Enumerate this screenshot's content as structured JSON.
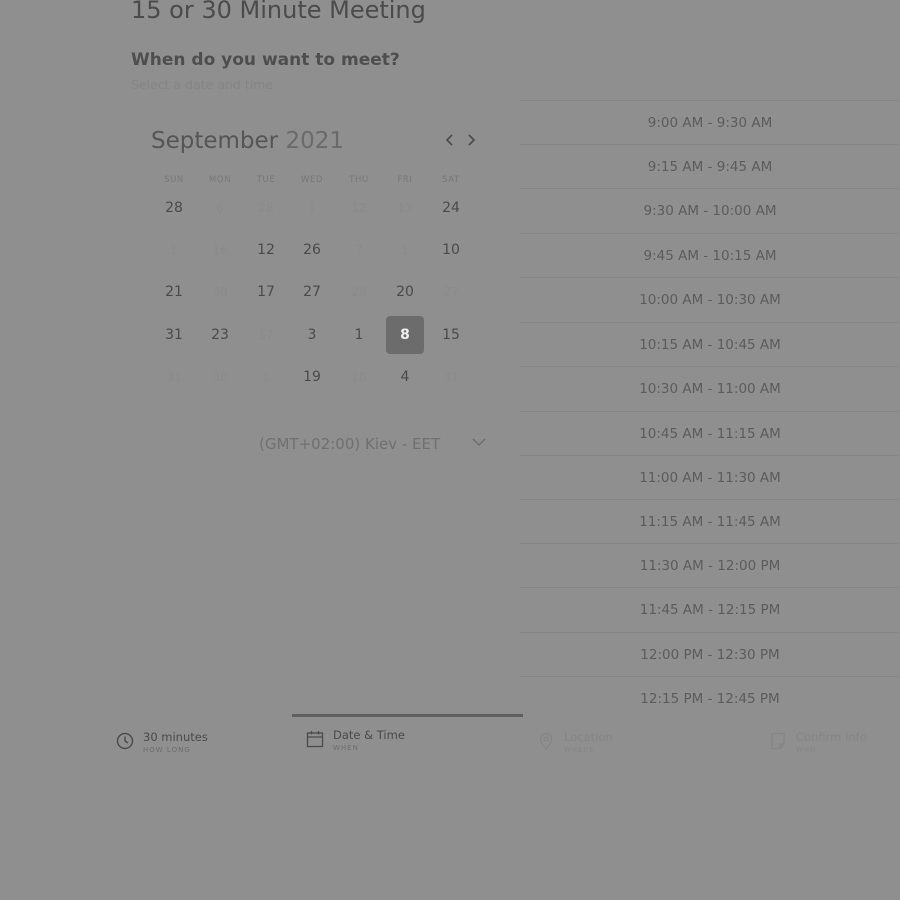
{
  "page": {
    "title": "15 or 30 Minute Meeting",
    "question": "When do you want to meet?",
    "subtitle": "Select a date and time"
  },
  "calendar": {
    "month": "September",
    "year": "2021",
    "prev_icon": "chevron-left-icon",
    "next_icon": "chevron-right-icon",
    "weekdays": [
      "SUN",
      "MON",
      "TUE",
      "WED",
      "THU",
      "FRI",
      "SAT"
    ],
    "rows": [
      [
        "28",
        "6",
        "28",
        "1",
        "12",
        "13",
        "24"
      ],
      [
        "1",
        "16",
        "12",
        "26",
        "7",
        "1",
        "10"
      ],
      [
        "21",
        "30",
        "17",
        "27",
        "28",
        "20",
        "27"
      ],
      [
        "31",
        "23",
        "17",
        "3",
        "1",
        "8",
        "15"
      ],
      [
        "31",
        "30",
        "1",
        "19",
        "10",
        "4",
        "31"
      ]
    ],
    "selected_day": "8"
  },
  "timezone": {
    "label": "(GMT+02:00) Kiev - EET",
    "icon": "chevron-down-icon"
  },
  "time_slots": [
    "9:00 AM - 9:30 AM",
    "9:15 AM - 9:45 AM",
    "9:30 AM - 10:00 AM",
    "9:45 AM - 10:15 AM",
    "10:00 AM - 10:30 AM",
    "10:15 AM - 10:45 AM",
    "10:30 AM - 11:00 AM",
    "10:45 AM - 11:15 AM",
    "11:00 AM - 11:30 AM",
    "11:15 AM - 11:45 AM",
    "11:30 AM - 12:00 PM",
    "11:45 AM - 12:15 PM",
    "12:00 PM - 12:30 PM",
    "12:15 PM - 12:45 PM"
  ],
  "steps": [
    {
      "label": "30 minutes",
      "sub": "HOW LONG",
      "icon": "clock-icon"
    },
    {
      "label": "Date & Time",
      "sub": "WHEN",
      "icon": "calendar-icon"
    },
    {
      "label": "Location",
      "sub": "WHERE",
      "icon": "location-pin-icon"
    },
    {
      "label": "Confirm Info",
      "sub": "WHO",
      "icon": "document-icon"
    }
  ]
}
